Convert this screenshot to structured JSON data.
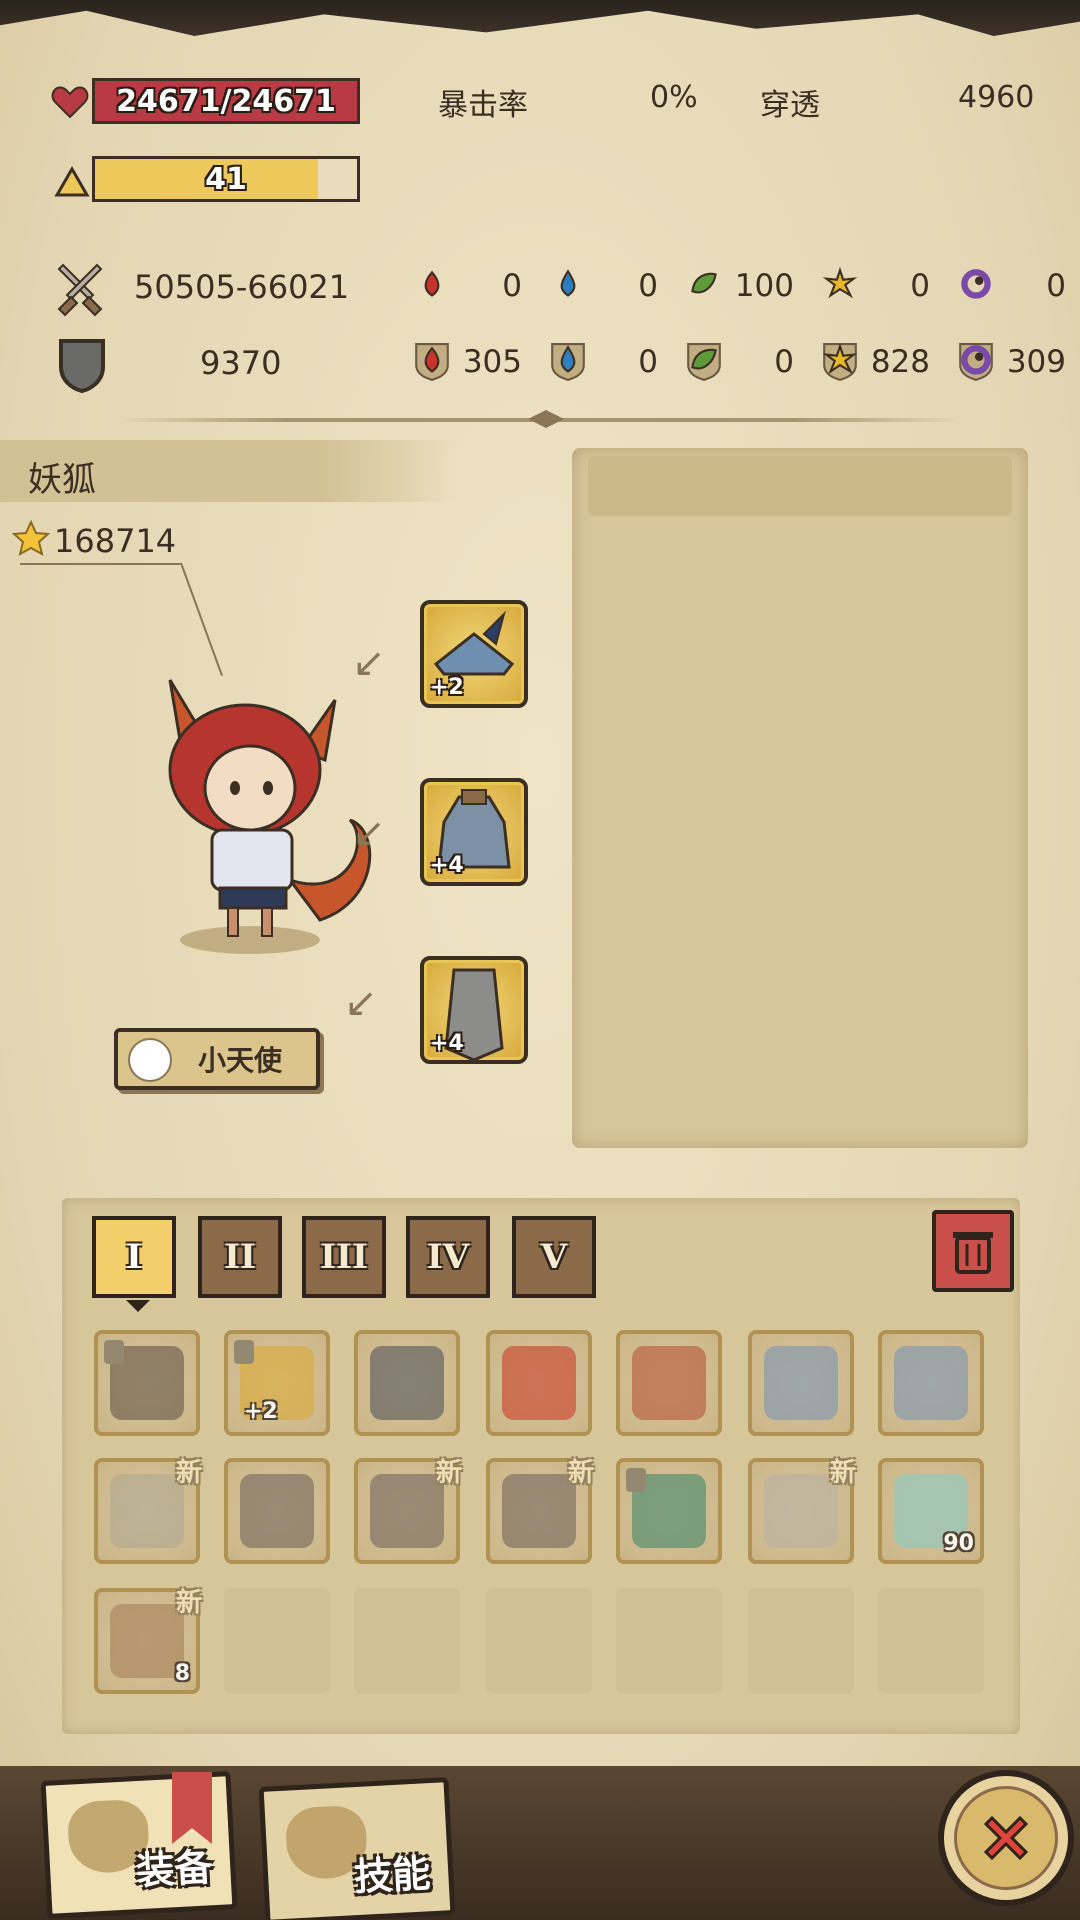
{
  "stats": {
    "hp_text": "24671/24671",
    "hp_fraction": 1.0,
    "level_text": "41",
    "level_fraction": 0.85,
    "crit_label": "暴击率",
    "crit_value": "0%",
    "pierce_label": "穿透",
    "pierce_value": "4960",
    "attack_value": "50505-66021",
    "defense_value": "9370",
    "attack_elements": [
      "0",
      "0",
      "100",
      "0",
      "0"
    ],
    "defense_elements": [
      "305",
      "0",
      "0",
      "828",
      "309"
    ]
  },
  "character": {
    "name": "妖狐",
    "power": "168714",
    "title_button": "小天使"
  },
  "equipped": {
    "helmet_plus": "+2",
    "armor_plus": "+4",
    "cloak_plus": "+4"
  },
  "inventory": {
    "tabs": [
      "I",
      "II",
      "III",
      "IV",
      "V"
    ],
    "active_tab": 0,
    "items": [
      {
        "name": "sword",
        "plus": "",
        "new": "",
        "count": "",
        "locked": true
      },
      {
        "name": "crown",
        "plus": "+2",
        "new": "",
        "count": "",
        "locked": true
      },
      {
        "name": "helmet",
        "plus": "",
        "new": "",
        "count": "",
        "locked": false
      },
      {
        "name": "fire-emblem",
        "plus": "",
        "new": "",
        "count": "",
        "locked": false
      },
      {
        "name": "spiked-armor",
        "plus": "",
        "new": "",
        "count": "",
        "locked": false
      },
      {
        "name": "plate-armor",
        "plus": "",
        "new": "",
        "count": "",
        "locked": false
      },
      {
        "name": "plate-armor",
        "plus": "",
        "new": "",
        "count": "",
        "locked": false
      },
      {
        "name": "chest-armor",
        "plus": "",
        "new": "新",
        "count": "",
        "locked": false
      },
      {
        "name": "boots",
        "plus": "",
        "new": "",
        "count": "",
        "locked": false
      },
      {
        "name": "boots",
        "plus": "",
        "new": "新",
        "count": "",
        "locked": false
      },
      {
        "name": "boots",
        "plus": "",
        "new": "新",
        "count": "",
        "locked": false
      },
      {
        "name": "claw-glove",
        "plus": "",
        "new": "",
        "count": "",
        "locked": true
      },
      {
        "name": "gauntlet",
        "plus": "",
        "new": "新",
        "count": "",
        "locked": false
      },
      {
        "name": "potion",
        "plus": "",
        "new": "",
        "count": "90",
        "locked": false
      },
      {
        "name": "chest-box",
        "plus": "",
        "new": "新",
        "count": "8",
        "locked": false
      }
    ]
  },
  "bottom_nav": {
    "equip_label": "装备",
    "skill_label": "技能"
  },
  "colors": {
    "hp": "#b83a44",
    "level": "#ecc95a",
    "fire": "#c8342c",
    "water": "#2f7fc0",
    "nature": "#5f9a3a",
    "light": "#e8b82a",
    "dark": "#7a4aa8"
  }
}
